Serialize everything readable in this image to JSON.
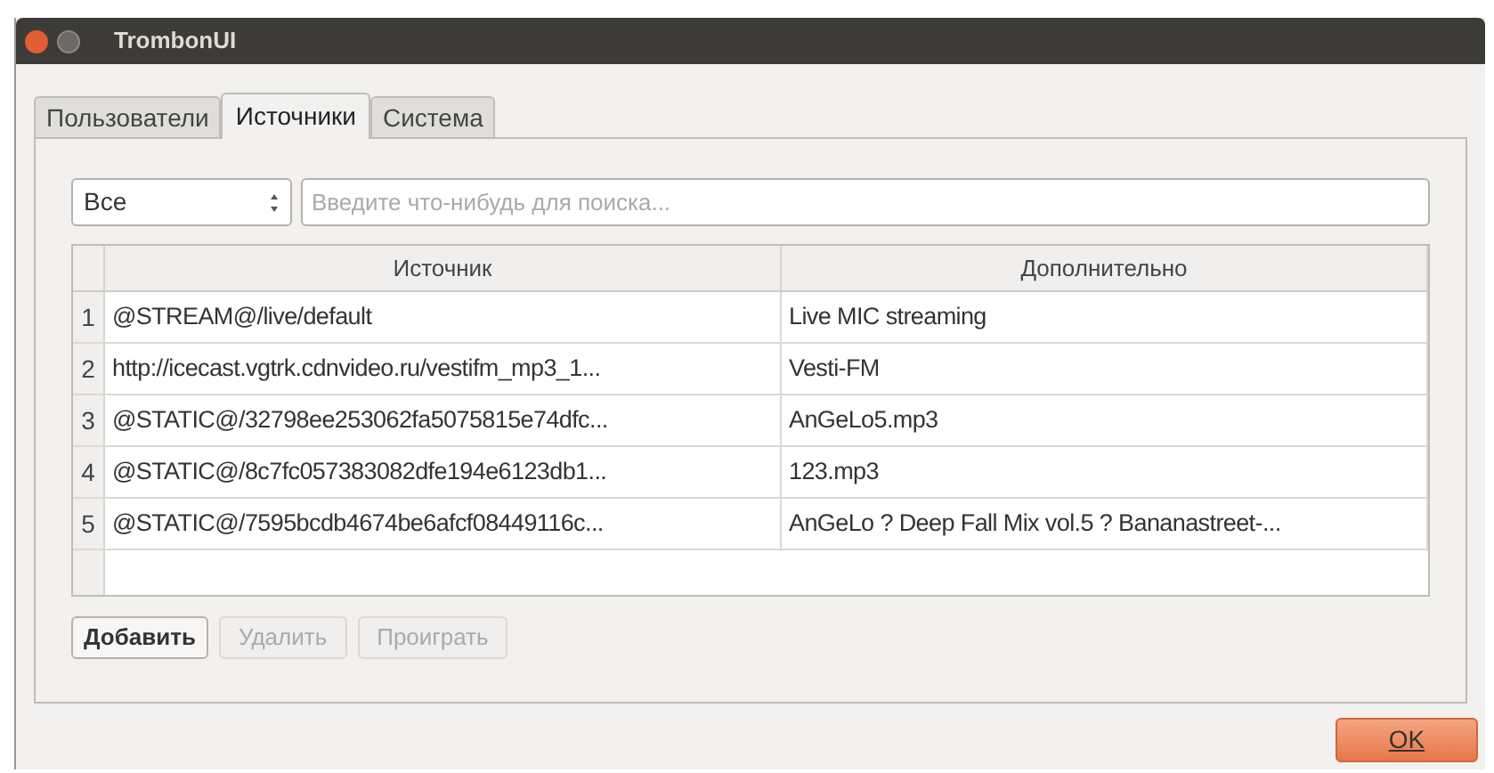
{
  "window": {
    "title": "TrombonUI"
  },
  "tabs": [
    {
      "label": "Пользователи",
      "selected": false
    },
    {
      "label": "Источники",
      "selected": true
    },
    {
      "label": "Система",
      "selected": false
    }
  ],
  "filter": {
    "value": "Все"
  },
  "search": {
    "placeholder": "Введите что-нибудь для поиска..."
  },
  "table": {
    "columns": [
      "Источник",
      "Дополнительно"
    ],
    "rows": [
      {
        "number": "1",
        "source": "@STREAM@/live/default",
        "extra": "Live MIC streaming"
      },
      {
        "number": "2",
        "source": "http://icecast.vgtrk.cdnvideo.ru/vestifm_mp3_1...",
        "extra": "Vesti-FM"
      },
      {
        "number": "3",
        "source": "@STATIC@/32798ee253062fa5075815e74dfc...",
        "extra": "AnGeLo5.mp3"
      },
      {
        "number": "4",
        "source": "@STATIC@/8c7fc057383082dfe194e6123db1...",
        "extra": "123.mp3"
      },
      {
        "number": "5",
        "source": "@STATIC@/7595bcdb4674be6afcf08449116c...",
        "extra": "AnGeLo ? Deep Fall Mix vol.5 ? Bananastreet-..."
      }
    ]
  },
  "buttons": [
    {
      "label": "Добавить",
      "disabled": false
    },
    {
      "label": "Удалить",
      "disabled": true
    },
    {
      "label": "Проиграть",
      "disabled": true
    }
  ],
  "ok_button": {
    "label": "OK"
  }
}
